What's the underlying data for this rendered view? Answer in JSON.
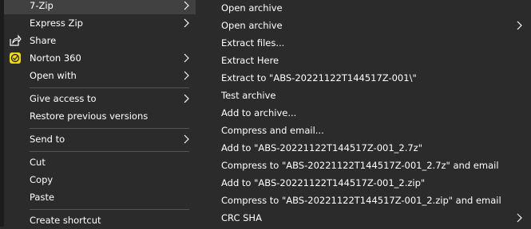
{
  "left_menu": {
    "items": [
      {
        "label": "7-Zip",
        "submenu": true
      },
      {
        "label": "Express Zip",
        "submenu": true
      },
      {
        "label": "Share",
        "icon": "share-icon"
      },
      {
        "label": "Norton 360",
        "icon": "norton-icon",
        "submenu": true
      },
      {
        "label": "Open with",
        "submenu": true
      },
      {
        "label": "Give access to",
        "submenu": true
      },
      {
        "label": "Restore previous versions"
      },
      {
        "label": "Send to",
        "submenu": true
      },
      {
        "label": "Cut"
      },
      {
        "label": "Copy"
      },
      {
        "label": "Paste"
      },
      {
        "label": "Create shortcut"
      }
    ]
  },
  "right_menu": {
    "items": [
      {
        "label": "Open archive"
      },
      {
        "label": "Open archive",
        "submenu": true
      },
      {
        "label": "Extract files..."
      },
      {
        "label": "Extract Here"
      },
      {
        "label": "Extract to \"ABS-20221122T144517Z-001\\\""
      },
      {
        "label": "Test archive"
      },
      {
        "label": "Add to archive..."
      },
      {
        "label": "Compress and email..."
      },
      {
        "label": "Add to \"ABS-20221122T144517Z-001_2.7z\""
      },
      {
        "label": "Compress to \"ABS-20221122T144517Z-001_2.7z\" and email"
      },
      {
        "label": "Add to \"ABS-20221122T144517Z-001_2.zip\""
      },
      {
        "label": "Compress to \"ABS-20221122T144517Z-001_2.zip\" and email"
      },
      {
        "label": "CRC SHA",
        "submenu": true
      }
    ]
  },
  "colors": {
    "menu_bg": "#2b2b2b",
    "hover_bg": "#414141",
    "separator": "#555555",
    "text": "#ffffff",
    "norton_yellow": "#f5d90a"
  }
}
